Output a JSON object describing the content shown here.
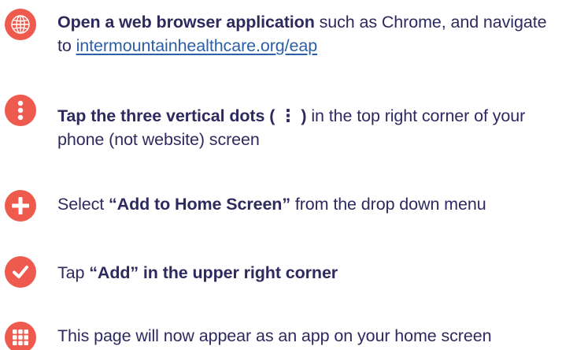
{
  "colors": {
    "icon_background": "#ef5a4e",
    "text": "#2e2a5e",
    "link": "#2b5fa8"
  },
  "steps": [
    {
      "icon": "globe-icon",
      "bold": "Open a web browser application",
      "text": " such as Chrome, and navigate to ",
      "link": "intermountainhealthcare.org/eap"
    },
    {
      "icon": "three-vertical-dots-icon",
      "bold": "Tap the three vertical dots ( ⋮ )",
      "text": " in the top right corner of your phone (not website) screen"
    },
    {
      "icon": "plus-icon",
      "prefix": "Select ",
      "bold": "“Add to Home Screen”",
      "text": " from the drop down menu"
    },
    {
      "icon": "checkmark-icon",
      "prefix": "Tap ",
      "bold": "“Add” in the upper right corner"
    },
    {
      "icon": "app-grid-icon",
      "text": "This page will now appear as an app on your home screen"
    }
  ]
}
